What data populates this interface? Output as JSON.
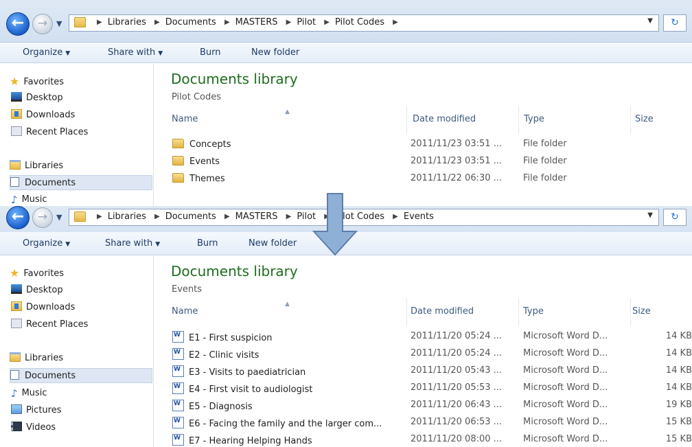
{
  "nav_buttons": {
    "back_glyph": "←",
    "forward_glyph": "→",
    "history_glyph": "▼"
  },
  "windows": [
    {
      "breadcrumb": [
        "Libraries",
        "Documents",
        "MASTERS",
        "Pilot",
        "Pilot Codes"
      ],
      "toolbar": {
        "organize": "Organize",
        "share_with": "Share with",
        "burn": "Burn",
        "new_folder": "New folder"
      },
      "nav": {
        "favorites": "Favorites",
        "desktop": "Desktop",
        "downloads": "Downloads",
        "recent_places": "Recent Places",
        "libraries": "Libraries",
        "documents": "Documents",
        "music": "Music"
      },
      "library_title": "Documents library",
      "library_subtitle": "Pilot Codes",
      "columns": {
        "name": "Name",
        "date_modified": "Date modified",
        "type": "Type",
        "size": "Size"
      },
      "rows": [
        {
          "name": "Concepts",
          "date": "2011/11/23 03:51 ...",
          "type": "File folder",
          "size": ""
        },
        {
          "name": "Events",
          "date": "2011/11/23 03:51 ...",
          "type": "File folder",
          "size": ""
        },
        {
          "name": "Themes",
          "date": "2011/11/22 06:30 ...",
          "type": "File folder",
          "size": ""
        }
      ]
    },
    {
      "breadcrumb": [
        "Libraries",
        "Documents",
        "MASTERS",
        "Pilot",
        "Pilot Codes",
        "Events"
      ],
      "toolbar": {
        "organize": "Organize",
        "share_with": "Share with",
        "burn": "Burn",
        "new_folder": "New folder"
      },
      "nav": {
        "favorites": "Favorites",
        "desktop": "Desktop",
        "downloads": "Downloads",
        "recent_places": "Recent Places",
        "libraries": "Libraries",
        "documents": "Documents",
        "music": "Music",
        "pictures": "Pictures",
        "videos": "Videos"
      },
      "library_title": "Documents library",
      "library_subtitle": "Events",
      "columns": {
        "name": "Name",
        "date_modified": "Date modified",
        "type": "Type",
        "size": "Size"
      },
      "rows": [
        {
          "name": "E1 - First suspicion",
          "date": "2011/11/20 05:24 ...",
          "type": "Microsoft Word D...",
          "size": "14 KB"
        },
        {
          "name": "E2 - Clinic visits",
          "date": "2011/11/20 05:24 ...",
          "type": "Microsoft Word D...",
          "size": "14 KB"
        },
        {
          "name": "E3 - Visits to paediatrician",
          "date": "2011/11/20 05:43 ...",
          "type": "Microsoft Word D...",
          "size": "14 KB"
        },
        {
          "name": "E4 - First visit to audiologist",
          "date": "2011/11/20 05:53 ...",
          "type": "Microsoft Word D...",
          "size": "14 KB"
        },
        {
          "name": "E5 - Diagnosis",
          "date": "2011/11/20 06:43 ...",
          "type": "Microsoft Word D...",
          "size": "19 KB"
        },
        {
          "name": "E6 - Facing the family and the larger com...",
          "date": "2011/11/20 06:53 ...",
          "type": "Microsoft Word D...",
          "size": "15 KB"
        },
        {
          "name": "E7 - Hearing Helping Hands",
          "date": "2011/11/20 08:00 ...",
          "type": "Microsoft Word D...",
          "size": "15 KB"
        }
      ]
    }
  ],
  "colors": {
    "accent_title": "#1d6d1d",
    "arrow_fill": "#8fb0d6",
    "arrow_stroke": "#5d7fa9"
  }
}
